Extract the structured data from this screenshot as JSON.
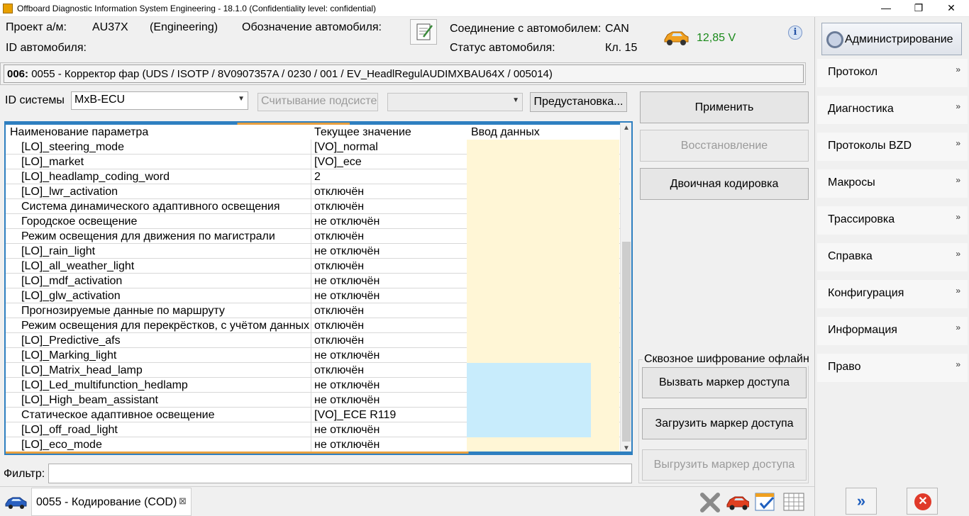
{
  "window": {
    "title": "Offboard Diagnostic Information System Engineering - 18.1.0 (Confidentiality level: confidential)",
    "controls": {
      "minimize": "—",
      "maximize": "❐",
      "close": "✕"
    }
  },
  "header": {
    "project_label": "Проект а/м:",
    "project_value": "AU37X",
    "mode_value": "(Engineering)",
    "vehicle_designation_label": "Обозначение автомобиля:",
    "vehicle_id_label": "ID автомобиля:",
    "connection_label": "Соединение с автомобилем:",
    "connection_value": "CAN",
    "status_label": "Статус автомобиля:",
    "status_value": "Кл. 15",
    "voltage": "12,85 V",
    "info_icon": "i"
  },
  "admin_button": "Администрирование",
  "right_menu": [
    "Протокол",
    "Диагностика",
    "Протоколы BZD",
    "Макросы",
    "Трассировка",
    "Справка",
    "Конфигурация",
    "Информация",
    "Право"
  ],
  "module_bar": {
    "id": "006:",
    "text": " 0055 - Корректор фар  (UDS / ISOTP / 8V0907357A / 0230 / 001 / EV_HeadlRegulAUDIMXBAU64X / 005014)"
  },
  "system": {
    "id_label": "ID системы",
    "id_value": "MxB-ECU",
    "subsystem_placeholder": "Считывание подсистем",
    "preset_button": "Предустановка..."
  },
  "actions": {
    "apply": "Применить",
    "restore": "Восстановление",
    "binary": "Двоичная кодировка"
  },
  "grid": {
    "headers": [
      "Наименование параметра",
      "Текущее значение",
      "Ввод данных"
    ],
    "rows": [
      {
        "name": "[LO]_steering_mode",
        "value": "[VO]_normal",
        "highlight": false
      },
      {
        "name": "[LO]_market",
        "value": "[VO]_ece",
        "highlight": false
      },
      {
        "name": "[LO]_headlamp_coding_word",
        "value": "2",
        "highlight": false
      },
      {
        "name": "[LO]_lwr_activation",
        "value": "отключён",
        "highlight": false
      },
      {
        "name": "Система динамического адаптивного освещения",
        "value": "отключён",
        "highlight": false
      },
      {
        "name": "Городское освещение",
        "value": "не отключён",
        "highlight": false
      },
      {
        "name": "Режим освещения для движения по магистрали",
        "value": "отключён",
        "highlight": false
      },
      {
        "name": "[LO]_rain_light",
        "value": "не отключён",
        "highlight": false
      },
      {
        "name": "[LO]_all_weather_light",
        "value": "отключён",
        "highlight": false
      },
      {
        "name": "[LO]_mdf_activation",
        "value": "не отключён",
        "highlight": false
      },
      {
        "name": "[LO]_glw_activation",
        "value": "не отключён",
        "highlight": false
      },
      {
        "name": "Прогнозируемые данные по маршруту",
        "value": "отключён",
        "highlight": false
      },
      {
        "name": "Режим освещения для перекрёстков, с учётом данных по",
        "value": "отключён",
        "highlight": false
      },
      {
        "name": "[LO]_Predictive_afs",
        "value": "отключён",
        "highlight": false
      },
      {
        "name": "[LO]_Marking_light",
        "value": "не отключён",
        "highlight": false
      },
      {
        "name": "[LO]_Matrix_head_lamp",
        "value": "отключён",
        "highlight": true
      },
      {
        "name": "[LO]_Led_multifunction_hedlamp",
        "value": "не отключён",
        "highlight": true
      },
      {
        "name": "[LO]_High_beam_assistant",
        "value": "не отключён",
        "highlight": true
      },
      {
        "name": "Статическое адаптивное освещение",
        "value": "[VO]_ECE R119",
        "highlight": true
      },
      {
        "name": "[LO]_off_road_light",
        "value": "не отключён",
        "highlight": true
      },
      {
        "name": "[LO]_eco_mode",
        "value": "не отключён",
        "highlight": false
      }
    ]
  },
  "filter": {
    "label": "Фильтр:",
    "value": ""
  },
  "offline_encryption": {
    "title": "Сквозное шифрование офлайн",
    "call_token": "Вызвать маркер доступа",
    "load_token": "Загрузить маркер доступа",
    "unload_token": "Выгрузить маркер доступа"
  },
  "bottom_tab": {
    "label": "0055 - Кодирование (COD)",
    "close": "⊠"
  },
  "bottom_icons": [
    "delete-icon",
    "vehicle-icon",
    "checklist-icon",
    "table-icon"
  ],
  "colors": {
    "voltage": "#1a8a1a",
    "grid_border": "#2e7fc0",
    "input_cell": "#fff6d6",
    "highlight_cell": "#c8ecfc"
  }
}
